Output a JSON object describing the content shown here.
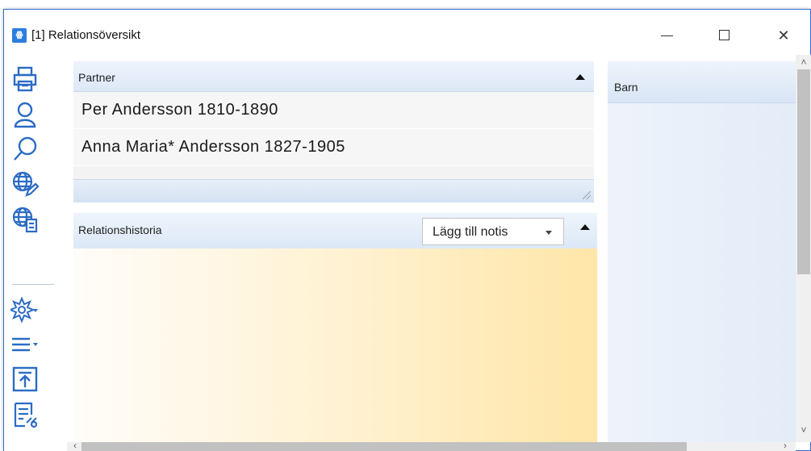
{
  "window": {
    "title": "[1] Relationsöversikt",
    "app_icon_text": "ꙮ"
  },
  "toolbar": {
    "icons": [
      "printer-icon",
      "person-icon",
      "search-icon",
      "globe-edit-icon",
      "globe-document-icon",
      "star-menu-icon",
      "list-menu-icon",
      "export-icon",
      "report-icon"
    ]
  },
  "partner": {
    "header": "Partner",
    "rows": [
      {
        "name": "Per  Andersson  1810-1890"
      },
      {
        "name": "Anna  Maria*  Andersson  1827-1905"
      }
    ]
  },
  "history": {
    "header": "Relationshistoria",
    "add_note_label": "Lägg till notis"
  },
  "barn": {
    "header": "Barn"
  },
  "colors": {
    "accent": "#2b6bc4",
    "window_border": "#2e6fd1",
    "header_gradient_top": "#eef4fc",
    "history_gradient_end": "#ffe6a8"
  }
}
